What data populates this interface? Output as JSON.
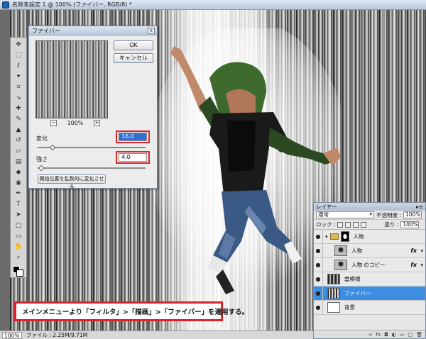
{
  "document": {
    "title": "名称未設定 1 @ 100% (ファイバー, RGB/8) *",
    "zoom": "100%",
    "file_info": "ファイル : 2.25M/9.71M"
  },
  "tools": {
    "icons": [
      "move-icon",
      "marquee-icon",
      "lasso-icon",
      "magic-wand-icon",
      "crop-icon",
      "eyedropper-icon",
      "healing-brush-icon",
      "brush-icon",
      "clone-stamp-icon",
      "history-brush-icon",
      "eraser-icon",
      "gradient-icon",
      "blur-icon",
      "dodge-icon",
      "pen-icon",
      "type-icon",
      "path-select-icon",
      "shape-icon",
      "notes-icon",
      "hand-icon",
      "zoom-icon"
    ]
  },
  "dialog": {
    "title": "ファイバー",
    "ok_label": "OK",
    "cancel_label": "キャンセル",
    "zoom_level": "100%",
    "zoom_minus": "−",
    "zoom_plus": "+",
    "variance_label": "変化",
    "variance_value": "16.0",
    "strength_label": "強さ",
    "strength_value": "4.0",
    "randomize_label": "開始位置を乱数的に変化させる",
    "close_glyph": "x"
  },
  "caption": {
    "text": "メインメニューより「フィルタ」>「描画」>「ファイバー」を適用する。"
  },
  "layers_panel": {
    "tab_label": "レイヤー",
    "menu_glyph": "▸≡",
    "blend_mode": "通常",
    "opacity_label": "不透明度 :",
    "opacity_value": "100%",
    "lock_label": "ロック :",
    "fill_label": "塗り :",
    "fill_value": "100%",
    "eye_glyph": "●",
    "fx_label": "fx",
    "layers": [
      {
        "name": "人物",
        "type": "group"
      },
      {
        "name": "人物",
        "type": "layer",
        "fx": true
      },
      {
        "name": "人物 のコピー",
        "type": "layer",
        "fx": true
      },
      {
        "name": "雲模様",
        "type": "layer"
      },
      {
        "name": "ファイバー",
        "type": "layer",
        "active": true
      },
      {
        "name": "背景",
        "type": "layer"
      }
    ],
    "footer_icons": [
      "link-icon",
      "fx-icon",
      "mask-icon",
      "adjustment-icon",
      "folder-icon",
      "new-layer-icon",
      "trash-icon"
    ],
    "footer_glyphs": [
      "∞",
      "fx",
      "◘",
      "◐",
      "▭",
      "▢",
      "🗑"
    ]
  }
}
